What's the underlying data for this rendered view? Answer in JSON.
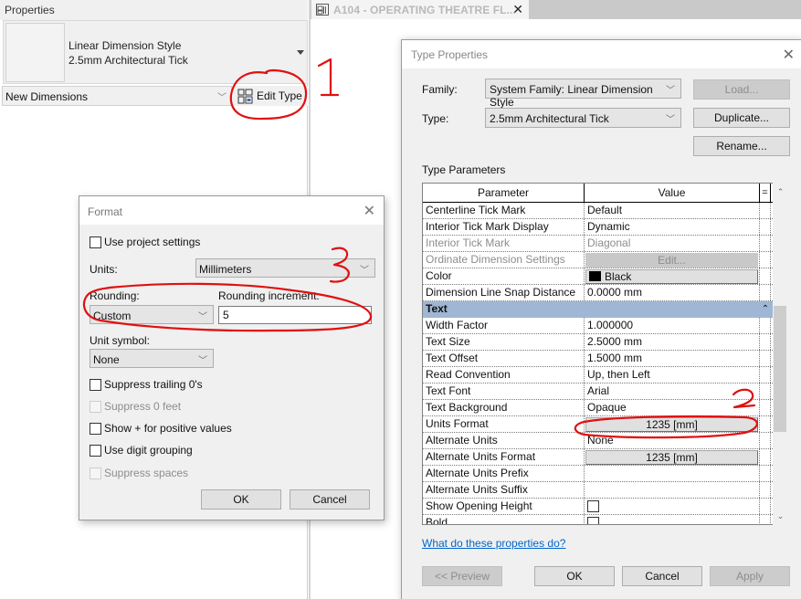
{
  "properties_panel": {
    "title": "Properties",
    "type_selector": {
      "family_line": "Linear Dimension Style",
      "type_line": "2.5mm Architectural Tick"
    },
    "instance_filter": "New Dimensions",
    "edit_type_label": "Edit Type"
  },
  "view_tab": {
    "label": "A104 - OPERATING THEATRE FL...",
    "close_glyph": "✕"
  },
  "type_properties": {
    "title": "Type Properties",
    "close_glyph": "✕",
    "family_label": "Family:",
    "family_value": "System Family: Linear Dimension Style",
    "type_label": "Type:",
    "type_value": "2.5mm Architectural Tick",
    "load_label": "Load...",
    "duplicate_label": "Duplicate...",
    "rename_label": "Rename...",
    "section_label": "Type Parameters",
    "columns": {
      "parameter": "Parameter",
      "value": "Value",
      "eq": "="
    },
    "rows_before": [
      {
        "name": "Centerline Tick Mark",
        "value": "Default"
      },
      {
        "name": "Interior Tick Mark Display",
        "value": "Dynamic"
      },
      {
        "name": "Interior Tick Mark",
        "value": "Diagonal",
        "disabled": true
      },
      {
        "name": "Ordinate Dimension Settings",
        "value": "Edit...",
        "disabled": true,
        "button": true
      },
      {
        "name": "Color",
        "value": "Black",
        "swatch": "#000000",
        "button": true
      },
      {
        "name": "Dimension Line Snap Distance",
        "value": "0.0000 mm"
      }
    ],
    "group_label": "Text",
    "group_collapse_glyph": "⌃",
    "rows_text": [
      {
        "name": "Width Factor",
        "value": "1.000000"
      },
      {
        "name": "Text Size",
        "value": "2.5000 mm"
      },
      {
        "name": "Text Offset",
        "value": "1.5000 mm"
      },
      {
        "name": "Read Convention",
        "value": "Up, then Left"
      },
      {
        "name": "Text Font",
        "value": "Arial"
      },
      {
        "name": "Text Background",
        "value": "Opaque"
      },
      {
        "name": "Units Format",
        "value": "1235 [mm]",
        "button": true
      },
      {
        "name": "Alternate Units",
        "value": "None"
      },
      {
        "name": "Alternate Units Format",
        "value": "1235 [mm]",
        "button": true
      },
      {
        "name": "Alternate Units Prefix",
        "value": ""
      },
      {
        "name": "Alternate Units Suffix",
        "value": ""
      },
      {
        "name": "Show Opening Height",
        "value": "",
        "checkbox": true,
        "checked": false
      },
      {
        "name": "Bold",
        "value": "",
        "checkbox": true,
        "checked": false
      }
    ],
    "help_link": "What do these properties do?",
    "preview_label": "<< Preview",
    "ok_label": "OK",
    "cancel_label": "Cancel",
    "apply_label": "Apply"
  },
  "format_dialog": {
    "title": "Format",
    "close_glyph": "✕",
    "use_project_settings": {
      "label": "Use project settings",
      "checked": false
    },
    "units_label": "Units:",
    "units_value": "Millimeters",
    "rounding_label": "Rounding:",
    "rounding_value": "Custom",
    "rounding_increment_label": "Rounding increment:",
    "rounding_increment_value": "5",
    "unit_symbol_label": "Unit symbol:",
    "unit_symbol_value": "None",
    "checks": [
      {
        "label": "Suppress trailing 0's",
        "checked": false,
        "disabled": false
      },
      {
        "label": "Suppress 0 feet",
        "checked": false,
        "disabled": true
      },
      {
        "label": "Show + for positive values",
        "checked": false,
        "disabled": false
      },
      {
        "label": "Use digit grouping",
        "checked": false,
        "disabled": false
      },
      {
        "label": "Suppress spaces",
        "checked": false,
        "disabled": true
      }
    ],
    "ok_label": "OK",
    "cancel_label": "Cancel"
  },
  "annotations": {
    "color": "#e01010",
    "step_1": "1",
    "step_2": "2",
    "step_3": "3"
  }
}
